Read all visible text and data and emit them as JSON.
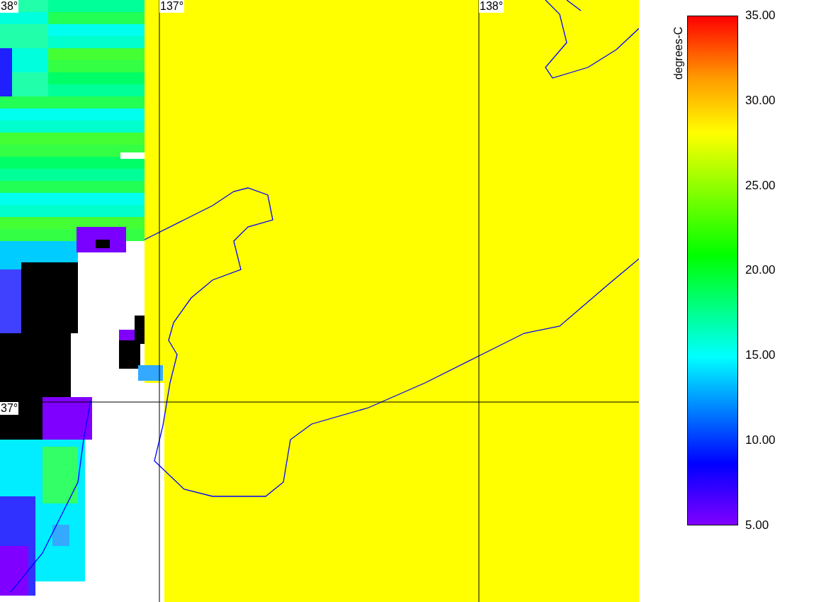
{
  "map": {
    "latitudes": [
      "38°",
      "37°"
    ],
    "longitudes": [
      "137°",
      "138°"
    ]
  },
  "colorbar": {
    "title": "degrees-C",
    "ticks": [
      "35.00",
      "30.00",
      "25.00",
      "20.00",
      "15.00",
      "10.00",
      "5.00"
    ]
  }
}
